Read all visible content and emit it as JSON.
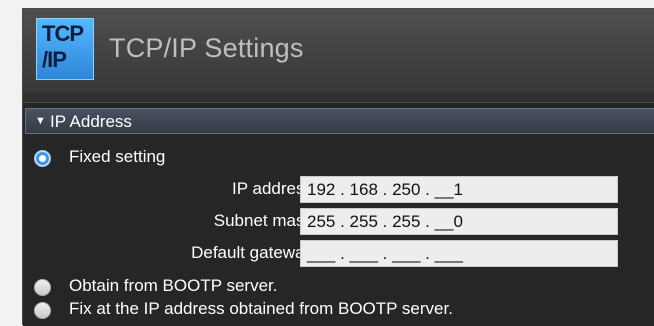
{
  "header": {
    "icon_top": "TCP",
    "icon_bottom": "/IP",
    "title": "TCP/IP Settings"
  },
  "section": {
    "label": "IP Address",
    "expanded_icon": "triangle-down-icon"
  },
  "options": {
    "fixed": {
      "label": "Fixed setting",
      "selected": true
    },
    "bootp": {
      "label": "Obtain from BOOTP server.",
      "selected": false
    },
    "fix_bootp": {
      "label": "Fix at the IP address obtained from BOOTP server.",
      "selected": false
    }
  },
  "fields": {
    "ip_address": {
      "label": "IP address",
      "value": "192 . 168 . 250 . __1"
    },
    "subnet_mask": {
      "label": "Subnet mask",
      "value": "255 . 255 . 255 . __0"
    },
    "default_gateway": {
      "label": "Default gateway",
      "value": "___ . ___ . ___ . ___"
    }
  },
  "colors": {
    "accent": "#3c92e8",
    "panel": "#262626",
    "header": "#444444",
    "field": "#ededed"
  }
}
